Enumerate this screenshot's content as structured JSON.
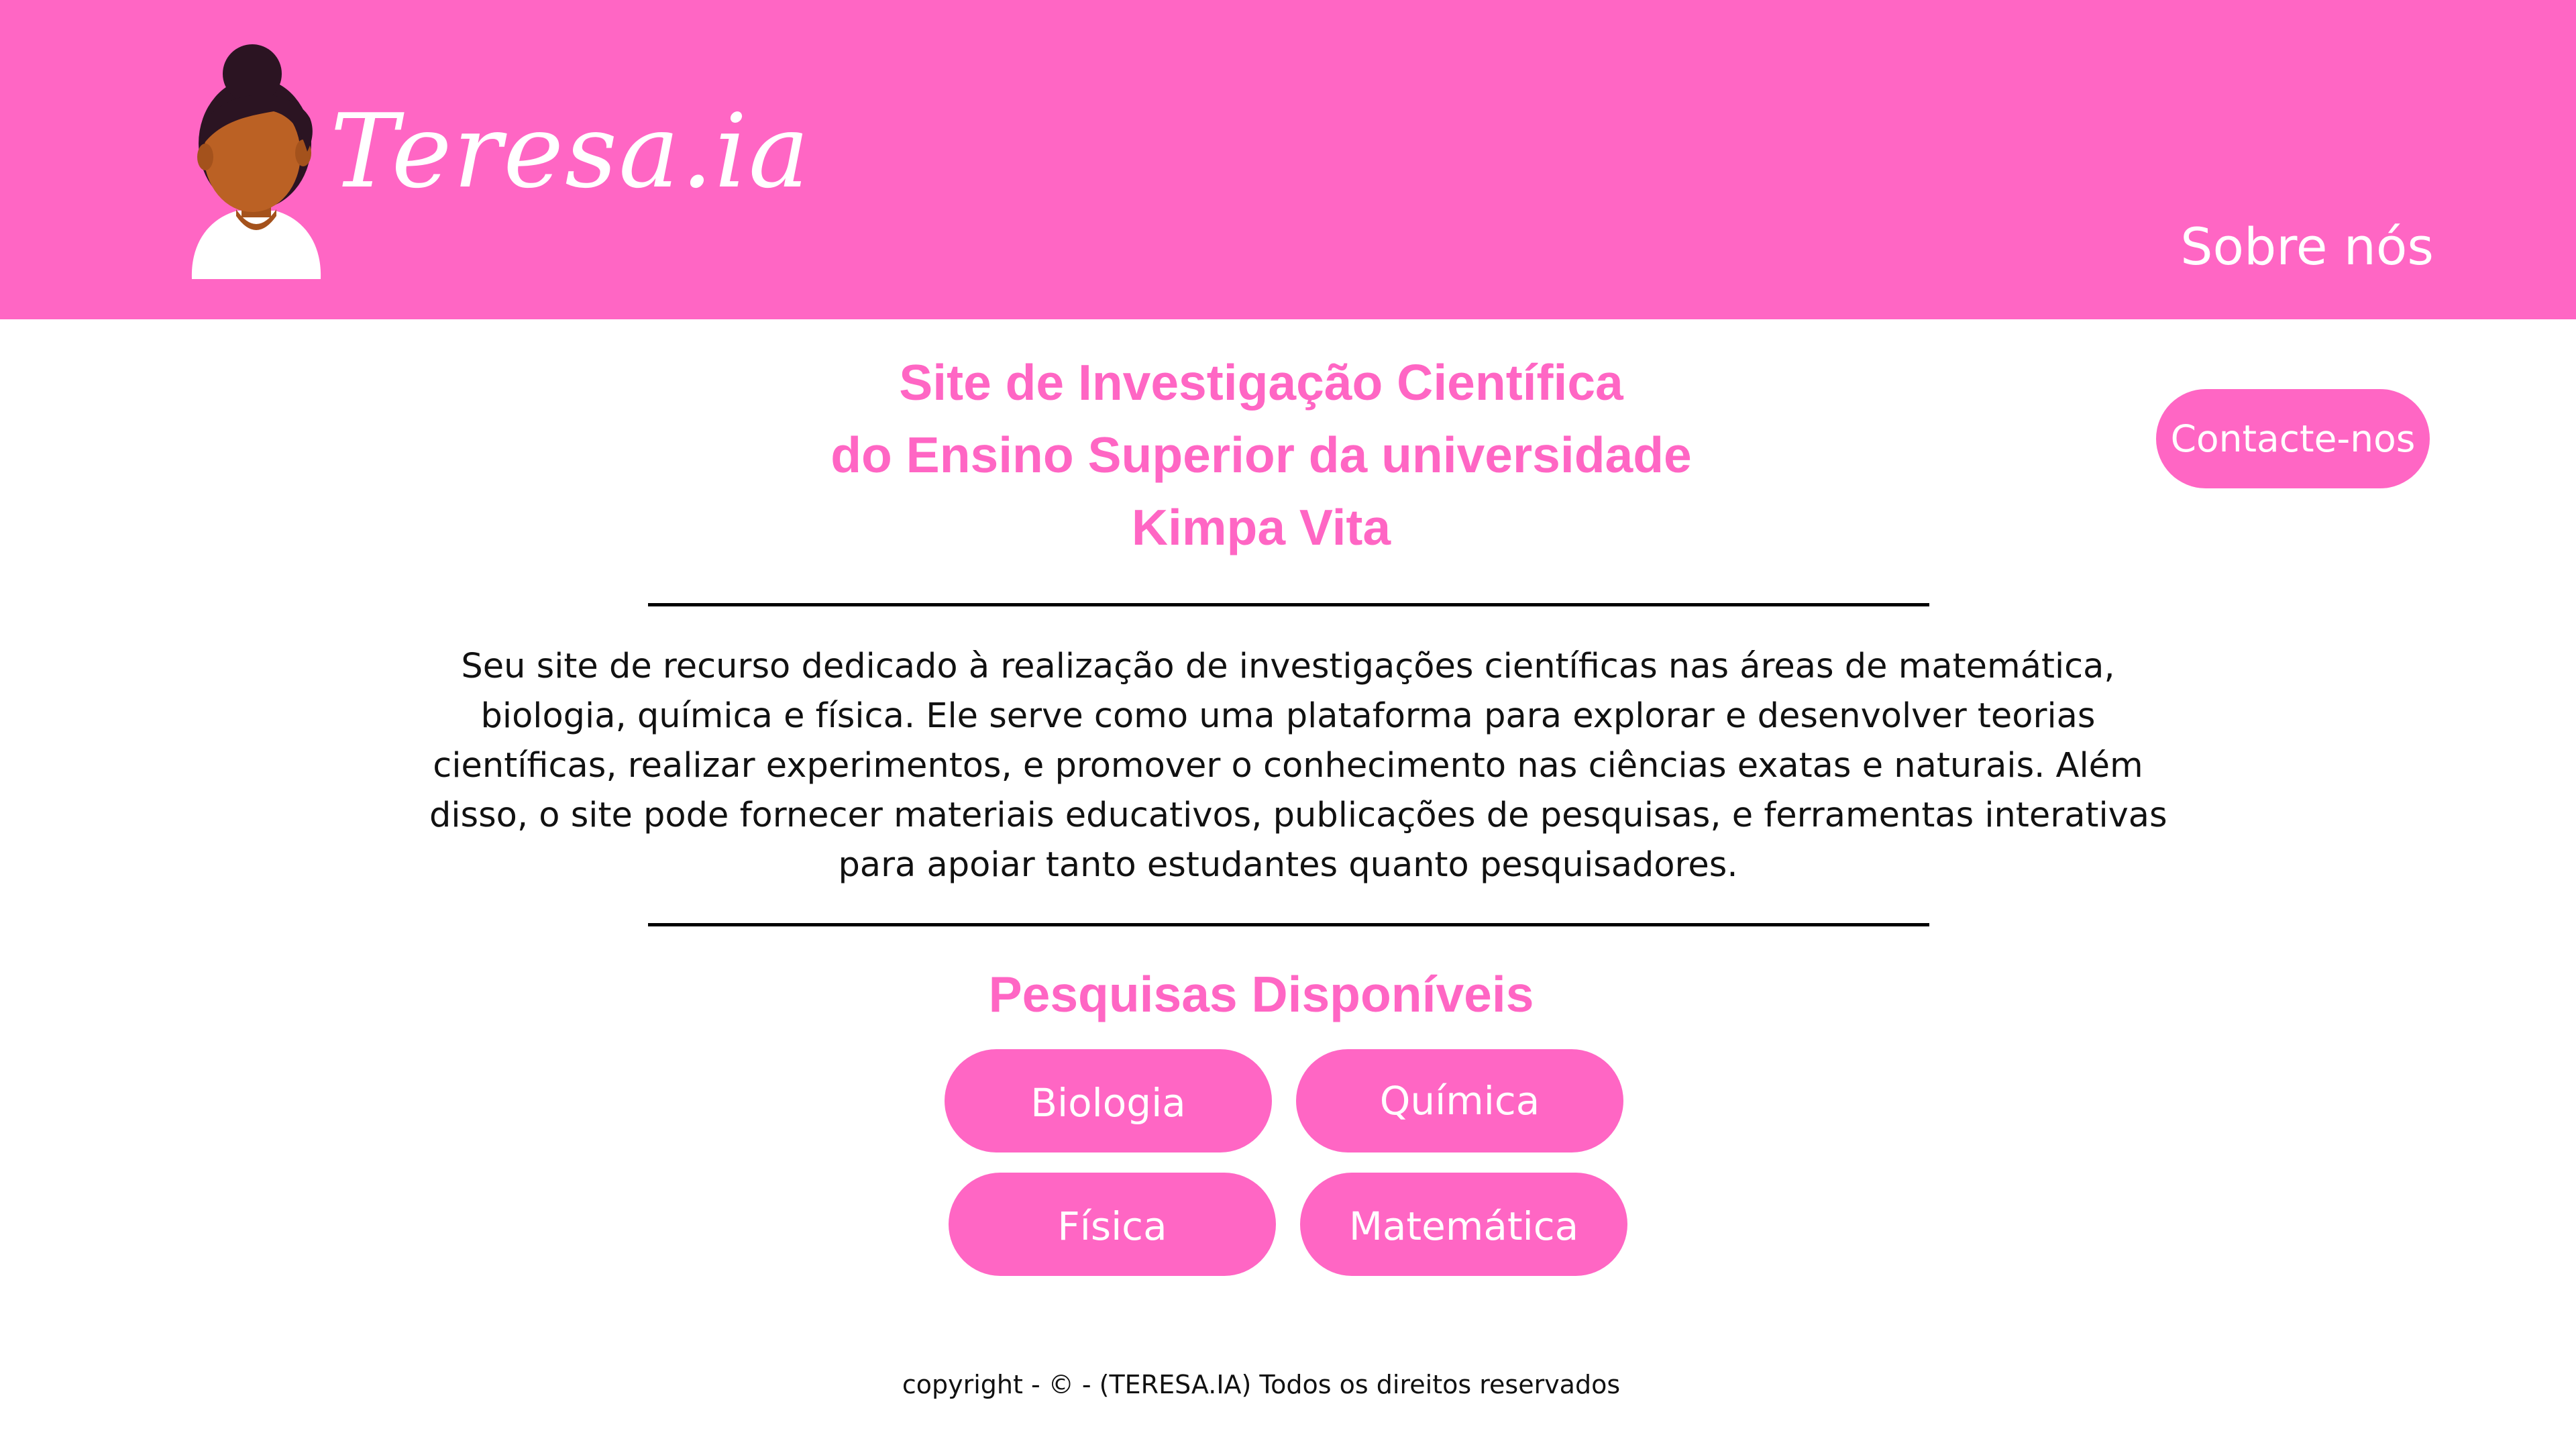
{
  "header": {
    "logo_text": "Teresa.ia",
    "nav_about": "Sobre nós",
    "background_color": "#ff66c4"
  },
  "contact_button": "Contacte-nos",
  "title_lines": [
    "Site de Investigação Científica",
    "do Ensino Superior da universidade",
    "Kimpa Vita"
  ],
  "description_lines": [
    "Seu site de recurso dedicado à realização de investigações científicas nas áreas de matemática,",
    "biologia, química e física. Ele serve como uma plataforma para explorar e desenvolver teorias",
    "científicas, realizar experimentos, e promover o conhecimento nas ciências exatas e naturais. Além",
    "disso, o site pode fornecer materiais educativos, publicações de pesquisas, e ferramentas interativas",
    "para apoiar tanto estudantes quanto pesquisadores."
  ],
  "research": {
    "title": "Pesquisas Disponíveis",
    "buttons": [
      "Biologia",
      "Química",
      "Física",
      "Matemática"
    ]
  },
  "footer": "copyright - © - (TERESA.IA) Todos os direitos reservados",
  "colors": {
    "accent": "#ff66c4",
    "text": "#111111",
    "white": "#ffffff"
  },
  "icons": {
    "logo": "woman-avatar-icon"
  }
}
